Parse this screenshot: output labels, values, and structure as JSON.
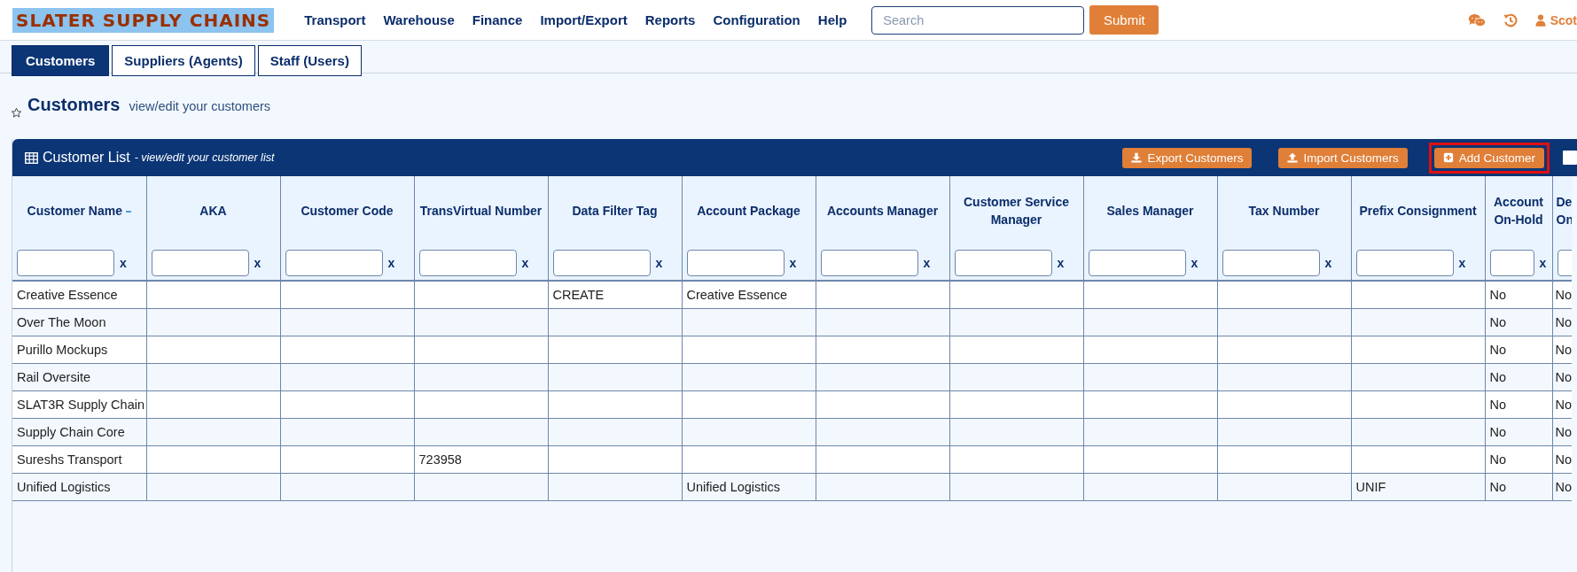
{
  "header": {
    "logo": "SLATER SUPPLY CHAINS",
    "nav": [
      "Transport",
      "Warehouse",
      "Finance",
      "Import/Export",
      "Reports",
      "Configuration",
      "Help"
    ],
    "search": {
      "placeholder": "Search"
    },
    "submit": "Submit",
    "user": "Scot"
  },
  "tabs": [
    {
      "label": "Customers",
      "selected": true
    },
    {
      "label": "Suppliers (Agents)",
      "selected": false
    },
    {
      "label": "Staff (Users)",
      "selected": false
    }
  ],
  "page": {
    "title": "Customers",
    "subtitle": "view/edit your customers"
  },
  "panel": {
    "title": "Customer List",
    "subtitle": "- view/edit your customer list",
    "buttons": [
      {
        "label": "Export Customers",
        "kind": "export",
        "highlighted": false
      },
      {
        "label": "Import Customers",
        "kind": "import",
        "highlighted": false
      },
      {
        "label": "Add Customer",
        "kind": "add",
        "highlighted": true
      }
    ],
    "checkbox": {
      "checked": false
    }
  },
  "table": {
    "columns": [
      {
        "label": "Customer Name",
        "sorted": true,
        "filter_clear": "x"
      },
      {
        "label": "AKA",
        "sorted": false,
        "filter_clear": "x"
      },
      {
        "label": "Customer Code",
        "sorted": false,
        "filter_clear": "x"
      },
      {
        "label": "TransVirtual Number",
        "sorted": false,
        "filter_clear": "x"
      },
      {
        "label": "Data Filter Tag",
        "sorted": false,
        "filter_clear": "x"
      },
      {
        "label": "Account Package",
        "sorted": false,
        "filter_clear": "x"
      },
      {
        "label": "Accounts Manager",
        "sorted": false,
        "filter_clear": "x"
      },
      {
        "label": "Customer Service Manager",
        "sorted": false,
        "filter_clear": "x"
      },
      {
        "label": "Sales Manager",
        "sorted": false,
        "filter_clear": "x"
      },
      {
        "label": "Tax Number",
        "sorted": false,
        "filter_clear": "x"
      },
      {
        "label": "Prefix Consignment",
        "sorted": false,
        "filter_clear": "x"
      },
      {
        "label": "Account On-Hold",
        "sorted": false,
        "filter_clear": "x"
      },
      {
        "label": "De On",
        "sorted": false
      }
    ],
    "rows": [
      {
        "customer_name": "Creative Essence",
        "data_filter_tag": "CREATE",
        "account_package": "Creative Essence",
        "account_on_hold": "No",
        "column_13": "No"
      },
      {
        "customer_name": "Over The Moon",
        "account_on_hold": "No",
        "column_13": "No"
      },
      {
        "customer_name": "Purillo Mockups",
        "account_on_hold": "No",
        "column_13": "No"
      },
      {
        "customer_name": "Rail Oversite",
        "account_on_hold": "No",
        "column_13": "No"
      },
      {
        "customer_name": "SLAT3R Supply Chain",
        "account_on_hold": "No",
        "column_13": "No"
      },
      {
        "customer_name": "Supply Chain Core",
        "account_on_hold": "No",
        "column_13": "No"
      },
      {
        "customer_name": "Sureshs Transport",
        "transvirtual_number": "723958",
        "account_on_hold": "No",
        "column_13": "No"
      },
      {
        "customer_name": "Unified Logistics",
        "account_package": "Unified Logistics",
        "prefix_consignment": "UNIF",
        "account_on_hold": "No",
        "column_13": "No"
      }
    ]
  }
}
